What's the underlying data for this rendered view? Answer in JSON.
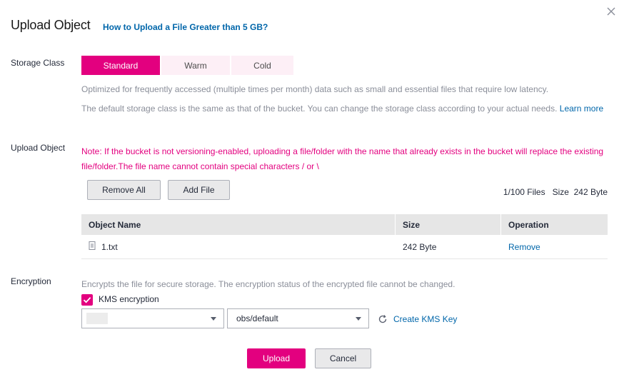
{
  "dialog": {
    "title": "Upload Object",
    "help_link": "How to Upload a File Greater than 5 GB?"
  },
  "storage_class": {
    "label": "Storage Class",
    "options": [
      "Standard",
      "Warm",
      "Cold"
    ],
    "selected": "Standard",
    "description": "Optimized for frequently accessed (multiple times per month) data such as small and essential files that require low latency.",
    "default_note": "The default storage class is the same as that of the bucket. You can change the storage class according to your actual needs.",
    "learn_more": "Learn more"
  },
  "upload_object": {
    "label": "Upload Object",
    "note": "Note: If the bucket is not versioning-enabled, uploading a file/folder with the name that already exists in the bucket will replace the existing file/folder.The file name cannot contain special characters / or \\",
    "remove_all_label": "Remove All",
    "add_file_label": "Add File",
    "files_info": "1/100 Files   Size  242 Byte",
    "table": {
      "columns": [
        "Object Name",
        "Size",
        "Operation"
      ],
      "rows": [
        {
          "name": "1.txt",
          "size": "242 Byte",
          "operation": "Remove"
        }
      ]
    }
  },
  "encryption": {
    "label": "Encryption",
    "description": "Encrypts the file for secure storage. The encryption status of the encrypted file cannot be changed.",
    "kms_label": "KMS encryption",
    "kms_checked": true,
    "project_select_value": "",
    "key_select_value": "obs/default",
    "create_key_label": "Create KMS Key"
  },
  "footer": {
    "upload_label": "Upload",
    "cancel_label": "Cancel"
  },
  "colors": {
    "accent": "#e3007f",
    "link": "#0066aa",
    "muted_text": "#8a8e99"
  },
  "icons": [
    "close-icon",
    "file-icon",
    "check-icon",
    "chevron-down-icon",
    "refresh-icon"
  ]
}
